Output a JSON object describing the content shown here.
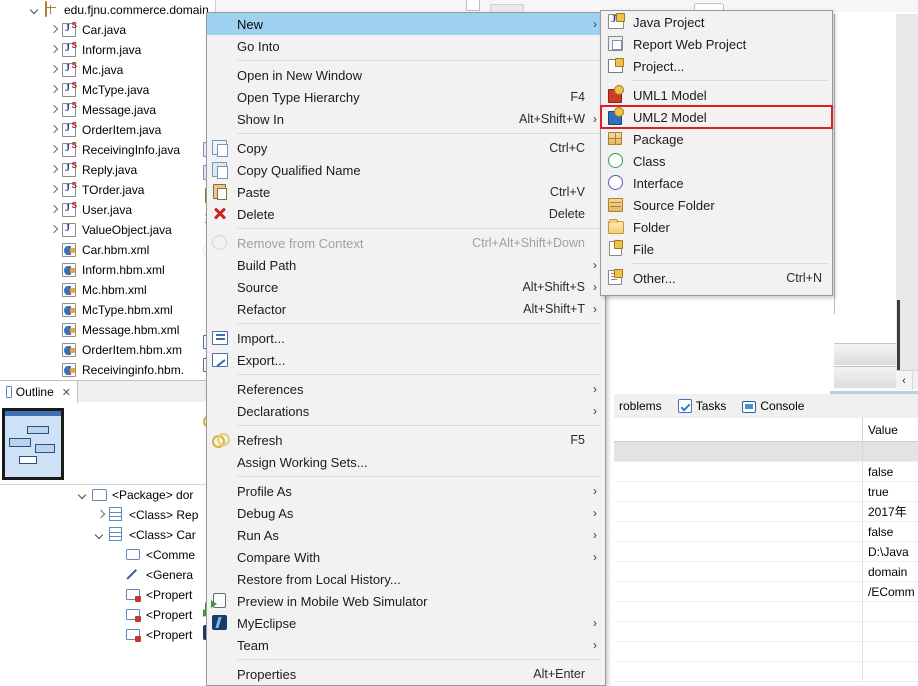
{
  "explorer": {
    "root": {
      "label": "edu.fjnu.commerce.domain",
      "icon": "package-icon",
      "expanded": true
    },
    "items": [
      {
        "label": "Car.java",
        "icon": "java-class-icon",
        "expandable": true
      },
      {
        "label": "Inform.java",
        "icon": "java-class-icon",
        "expandable": true
      },
      {
        "label": "Mc.java",
        "icon": "java-class-icon",
        "expandable": true
      },
      {
        "label": "McType.java",
        "icon": "java-class-icon",
        "expandable": true
      },
      {
        "label": "Message.java",
        "icon": "java-class-icon",
        "expandable": true
      },
      {
        "label": "OrderItem.java",
        "icon": "java-class-icon",
        "expandable": true
      },
      {
        "label": "ReceivingInfo.java",
        "icon": "java-class-icon",
        "expandable": true
      },
      {
        "label": "Reply.java",
        "icon": "java-class-icon",
        "expandable": true
      },
      {
        "label": "TOrder.java",
        "icon": "java-class-icon",
        "expandable": true
      },
      {
        "label": "User.java",
        "icon": "java-class-icon",
        "expandable": true
      },
      {
        "label": "ValueObject.java",
        "icon": "java-interface-icon",
        "expandable": true
      },
      {
        "label": "Car.hbm.xml",
        "icon": "hibernate-mapping-icon",
        "expandable": false
      },
      {
        "label": "Inform.hbm.xml",
        "icon": "hibernate-mapping-icon",
        "expandable": false
      },
      {
        "label": "Mc.hbm.xml",
        "icon": "hibernate-mapping-icon",
        "expandable": false
      },
      {
        "label": "McType.hbm.xml",
        "icon": "hibernate-mapping-icon",
        "expandable": false
      },
      {
        "label": "Message.hbm.xml",
        "icon": "hibernate-mapping-icon",
        "expandable": false
      },
      {
        "label": "OrderItem.hbm.xm",
        "icon": "hibernate-mapping-icon",
        "expandable": false
      },
      {
        "label": "Receivinginfo.hbm.",
        "icon": "hibernate-mapping-icon",
        "expandable": false
      }
    ]
  },
  "outline": {
    "tab_label": "Outline",
    "tab_close": "✕",
    "items": [
      {
        "label": "<Package> dor",
        "icon": "package-outline-icon",
        "indent": 0,
        "twisty": "down"
      },
      {
        "label": "<Class> Rep",
        "icon": "class-outline-icon",
        "indent": 1,
        "twisty": "right"
      },
      {
        "label": "<Class> Car",
        "icon": "class-outline-icon",
        "indent": 1,
        "twisty": "down"
      },
      {
        "label": "<Comme",
        "icon": "comment-outline-icon",
        "indent": 2,
        "twisty": "none"
      },
      {
        "label": "<Genera",
        "icon": "generalization-outline-icon",
        "indent": 2,
        "twisty": "none"
      },
      {
        "label": "<Propert",
        "icon": "property-outline-icon",
        "indent": 2,
        "twisty": "none"
      },
      {
        "label": "<Propert",
        "icon": "property-outline-icon",
        "indent": 2,
        "twisty": "none"
      },
      {
        "label": "<Propert",
        "icon": "property-outline-icon",
        "indent": 2,
        "twisty": "none"
      }
    ]
  },
  "context_menu": {
    "items": [
      {
        "label": "New",
        "accel": "",
        "arrow": true,
        "selected": true,
        "icon": "",
        "sep_after": false
      },
      {
        "label": "Go Into",
        "accel": "",
        "arrow": false,
        "selected": false,
        "icon": "",
        "sep_after": true
      },
      {
        "label": "Open in New Window",
        "accel": "",
        "arrow": false,
        "selected": false,
        "icon": "",
        "sep_after": false
      },
      {
        "label": "Open Type Hierarchy",
        "accel": "F4",
        "arrow": false,
        "selected": false,
        "icon": "",
        "sep_after": false
      },
      {
        "label": "Show In",
        "accel": "Alt+Shift+W",
        "arrow": true,
        "selected": false,
        "icon": "",
        "sep_after": true
      },
      {
        "label": "Copy",
        "accel": "Ctrl+C",
        "arrow": false,
        "selected": false,
        "icon": "copy-icon",
        "sep_after": false
      },
      {
        "label": "Copy Qualified Name",
        "accel": "",
        "arrow": false,
        "selected": false,
        "icon": "copy-qualified-name-icon",
        "sep_after": false
      },
      {
        "label": "Paste",
        "accel": "Ctrl+V",
        "arrow": false,
        "selected": false,
        "icon": "paste-icon",
        "sep_after": false
      },
      {
        "label": "Delete",
        "accel": "Delete",
        "arrow": false,
        "selected": false,
        "icon": "delete-icon",
        "sep_after": true
      },
      {
        "label": "Remove from Context",
        "accel": "Ctrl+Alt+Shift+Down",
        "arrow": false,
        "selected": false,
        "disabled": true,
        "icon": "remove-from-context-icon",
        "sep_after": false
      },
      {
        "label": "Build Path",
        "accel": "",
        "arrow": true,
        "selected": false,
        "icon": "",
        "sep_after": false
      },
      {
        "label": "Source",
        "accel": "Alt+Shift+S",
        "arrow": true,
        "selected": false,
        "icon": "",
        "sep_after": false
      },
      {
        "label": "Refactor",
        "accel": "Alt+Shift+T",
        "arrow": true,
        "selected": false,
        "icon": "",
        "sep_after": true
      },
      {
        "label": "Import...",
        "accel": "",
        "arrow": false,
        "selected": false,
        "icon": "import-icon",
        "sep_after": false
      },
      {
        "label": "Export...",
        "accel": "",
        "arrow": false,
        "selected": false,
        "icon": "export-icon",
        "sep_after": true
      },
      {
        "label": "References",
        "accel": "",
        "arrow": true,
        "selected": false,
        "icon": "",
        "sep_after": false
      },
      {
        "label": "Declarations",
        "accel": "",
        "arrow": true,
        "selected": false,
        "icon": "",
        "sep_after": true
      },
      {
        "label": "Refresh",
        "accel": "F5",
        "arrow": false,
        "selected": false,
        "icon": "refresh-icon",
        "sep_after": false
      },
      {
        "label": "Assign Working Sets...",
        "accel": "",
        "arrow": false,
        "selected": false,
        "icon": "",
        "sep_after": true
      },
      {
        "label": "Profile As",
        "accel": "",
        "arrow": true,
        "selected": false,
        "icon": "",
        "sep_after": false
      },
      {
        "label": "Debug As",
        "accel": "",
        "arrow": true,
        "selected": false,
        "icon": "",
        "sep_after": false
      },
      {
        "label": "Run As",
        "accel": "",
        "arrow": true,
        "selected": false,
        "icon": "",
        "sep_after": false
      },
      {
        "label": "Compare With",
        "accel": "",
        "arrow": true,
        "selected": false,
        "icon": "",
        "sep_after": false
      },
      {
        "label": "Restore from Local History...",
        "accel": "",
        "arrow": false,
        "selected": false,
        "icon": "",
        "sep_after": false
      },
      {
        "label": "Preview in Mobile Web Simulator",
        "accel": "",
        "arrow": false,
        "selected": false,
        "icon": "preview-mobile-icon",
        "sep_after": false
      },
      {
        "label": "MyEclipse",
        "accel": "",
        "arrow": true,
        "selected": false,
        "icon": "myeclipse-icon",
        "sep_after": false
      },
      {
        "label": "Team",
        "accel": "",
        "arrow": true,
        "selected": false,
        "icon": "",
        "sep_after": true
      },
      {
        "label": "Properties",
        "accel": "Alt+Enter",
        "arrow": false,
        "selected": false,
        "icon": "",
        "sep_after": false
      }
    ]
  },
  "submenu": {
    "items": [
      {
        "label": "Java Project",
        "accel": "",
        "icon": "java-project-icon",
        "boxed": false,
        "sep_after": false
      },
      {
        "label": "Report Web Project",
        "accel": "",
        "icon": "report-web-project-icon",
        "boxed": false,
        "sep_after": false
      },
      {
        "label": "Project...",
        "accel": "",
        "icon": "project-icon",
        "boxed": false,
        "sep_after": true
      },
      {
        "label": "UML1 Model",
        "accel": "",
        "icon": "uml1-model-icon",
        "boxed": false,
        "sep_after": false
      },
      {
        "label": "UML2 Model",
        "accel": "",
        "icon": "uml2-model-icon",
        "boxed": true,
        "sep_after": false
      },
      {
        "label": "Package",
        "accel": "",
        "icon": "package-icon",
        "boxed": false,
        "sep_after": false
      },
      {
        "label": "Class",
        "accel": "",
        "icon": "class-icon",
        "boxed": false,
        "sep_after": false
      },
      {
        "label": "Interface",
        "accel": "",
        "icon": "interface-icon",
        "boxed": false,
        "sep_after": false
      },
      {
        "label": "Source Folder",
        "accel": "",
        "icon": "source-folder-icon",
        "boxed": false,
        "sep_after": false
      },
      {
        "label": "Folder",
        "accel": "",
        "icon": "folder-icon",
        "boxed": false,
        "sep_after": false
      },
      {
        "label": "File",
        "accel": "",
        "icon": "file-icon",
        "boxed": false,
        "sep_after": true
      },
      {
        "label": "Other...",
        "accel": "Ctrl+N",
        "icon": "other-icon",
        "boxed": false,
        "sep_after": false
      }
    ],
    "highlight_color": "#e31b1b"
  },
  "bottom_panel": {
    "tabs": [
      {
        "label": "roblems",
        "icon": "problems-icon",
        "active": false
      },
      {
        "label": "Tasks",
        "icon": "tasks-icon",
        "active": false
      },
      {
        "label": "Console",
        "icon": "console-icon",
        "active": false
      }
    ],
    "table": {
      "value_header": "Value",
      "rows": [
        {
          "value": "",
          "group": true
        },
        {
          "value": "false",
          "group": false
        },
        {
          "value": "true",
          "group": false
        },
        {
          "value": "2017年",
          "group": false
        },
        {
          "value": "false",
          "group": false
        },
        {
          "value": "D:\\Java",
          "group": false
        },
        {
          "value": "domain",
          "group": false
        },
        {
          "value": "/EComm",
          "group": false
        },
        {
          "value": "",
          "group": false
        },
        {
          "value": "",
          "group": false
        },
        {
          "value": "",
          "group": false
        },
        {
          "value": "",
          "group": false
        }
      ]
    }
  },
  "editor": {
    "scroll_left_arrow": "‹"
  },
  "colors": {
    "menu_selection": "#9ed0f0",
    "menu_bg": "#f2f2f2",
    "highlight_red": "#e31b1b",
    "tree_text": "#000000"
  }
}
